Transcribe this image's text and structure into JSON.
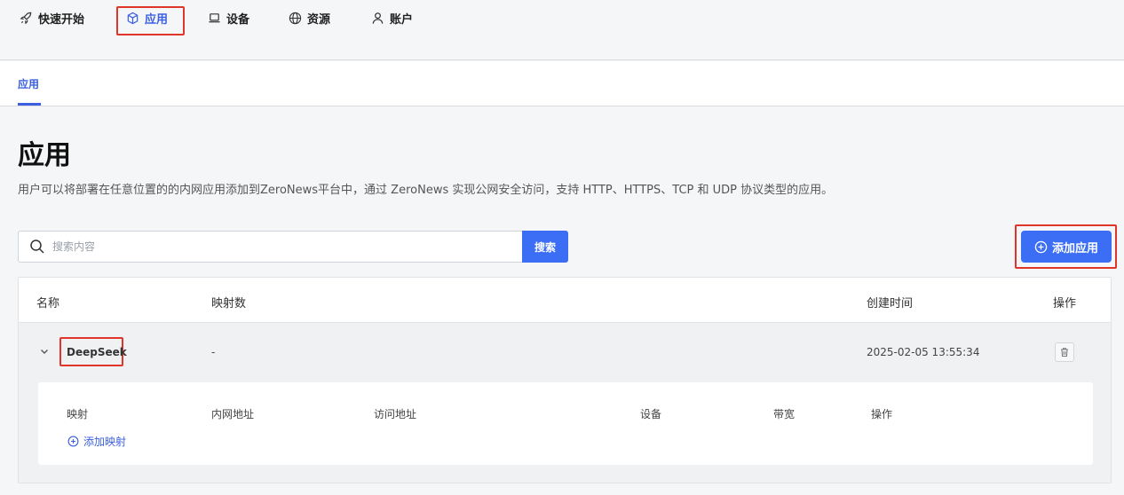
{
  "nav": {
    "items": [
      {
        "label": "快速开始",
        "icon": "rocket-icon"
      },
      {
        "label": "应用",
        "icon": "cube-icon"
      },
      {
        "label": "设备",
        "icon": "laptop-icon"
      },
      {
        "label": "资源",
        "icon": "globe-icon"
      },
      {
        "label": "账户",
        "icon": "user-icon"
      }
    ],
    "active_index": 1
  },
  "subtabs": {
    "active": "应用"
  },
  "page": {
    "title": "应用",
    "description": "用户可以将部署在任意位置的的内网应用添加到ZeroNews平台中，通过 ZeroNews 实现公网安全访问，支持 HTTP、HTTPS、TCP 和 UDP 协议类型的应用。"
  },
  "search": {
    "placeholder": "搜索内容",
    "value": "",
    "button_label": "搜索"
  },
  "add_app": {
    "label": "添加应用"
  },
  "table": {
    "headers": {
      "name": "名称",
      "mappings": "映射数",
      "created": "创建时间",
      "actions": "操作"
    },
    "rows": [
      {
        "name": "DeepSeek",
        "mappings": "-",
        "created": "2025-02-05 13:55:34",
        "expanded": true
      }
    ]
  },
  "mapping_table": {
    "headers": {
      "mapping": "映射",
      "internal": "内网地址",
      "access": "访问地址",
      "device": "设备",
      "bandwidth": "带宽",
      "actions": "操作"
    },
    "add_label": "添加映射"
  },
  "colors": {
    "accent": "#3b6ef5",
    "highlight": "#e0352b"
  }
}
